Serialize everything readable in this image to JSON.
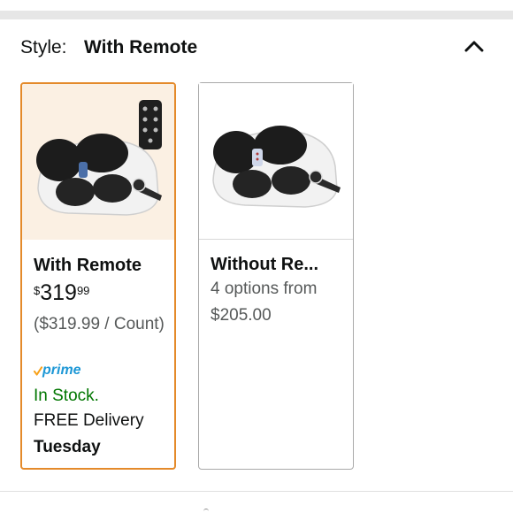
{
  "header": {
    "style_label": "Style:",
    "style_value": "With Remote",
    "collapse_icon": "chevron-up-icon"
  },
  "options": [
    {
      "title": "With Remote",
      "price_symbol": "$",
      "price_whole": "319",
      "price_fraction": "99",
      "unit_price": "($319.99 / Count)",
      "prime_label": "prime",
      "stock": "In Stock.",
      "delivery": "FREE Delivery",
      "delivery_day": "Tuesday",
      "selected": true
    },
    {
      "title": "Without Re...",
      "options_text": "4 options from",
      "from_price": "$205.00",
      "selected": false
    }
  ],
  "colors": {
    "selected_border": "#e48a2a",
    "in_stock": "#007600",
    "prime_blue": "#1e98d6",
    "prime_check": "#f7a11a"
  }
}
